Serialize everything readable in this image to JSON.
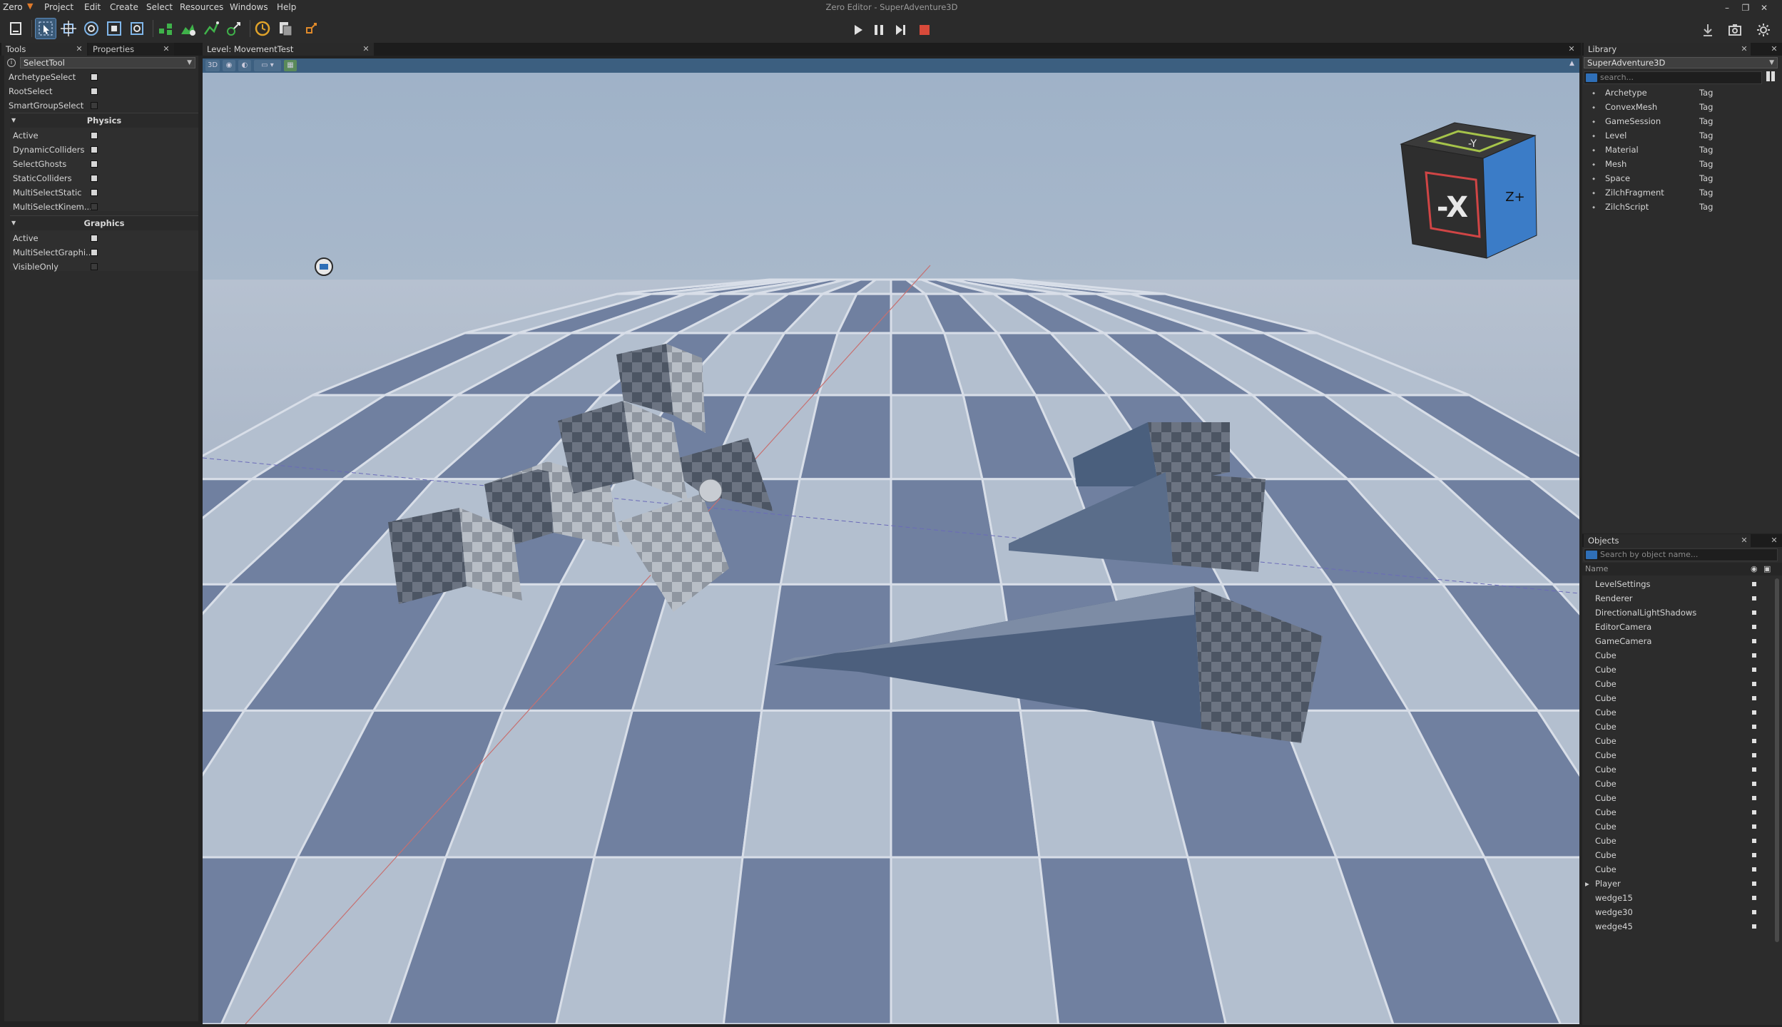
{
  "menu": {
    "logo": "Zero",
    "items": [
      "Project",
      "Edit",
      "Create",
      "Select",
      "Resources",
      "Windows",
      "Help"
    ],
    "title": "Zero Editor - SuperAdventure3D"
  },
  "colors": {
    "accent": "#3c5f80",
    "selection": "#2f6fb7",
    "stop": "#d84a3a",
    "tool_green": "#3fb24a",
    "tool_orange": "#e08a2a"
  },
  "tools_panel": {
    "tab_tools": "Tools",
    "tab_properties": "Properties",
    "selected_tool": "SelectTool",
    "top_props": [
      {
        "label": "ArchetypeSelect",
        "checked": true
      },
      {
        "label": "RootSelect",
        "checked": true
      },
      {
        "label": "SmartGroupSelect",
        "checked": false
      }
    ],
    "physics": {
      "title": "Physics",
      "props": [
        {
          "label": "Active",
          "checked": true
        },
        {
          "label": "DynamicColliders",
          "checked": true
        },
        {
          "label": "SelectGhosts",
          "checked": true
        },
        {
          "label": "StaticColliders",
          "checked": true
        },
        {
          "label": "MultiSelectStatic",
          "checked": true
        },
        {
          "label": "MultiSelectKinem...",
          "checked": false
        }
      ]
    },
    "graphics": {
      "title": "Graphics",
      "props": [
        {
          "label": "Active",
          "checked": true
        },
        {
          "label": "MultiSelectGraphi...",
          "checked": true
        },
        {
          "label": "VisibleOnly",
          "checked": false
        }
      ]
    }
  },
  "viewport": {
    "tab": "Level: MovementTest",
    "mode": "3D",
    "gizmo_label": "-X",
    "gizmo_top_label": "-Y",
    "gizmo_side_label": "Z+"
  },
  "library": {
    "tab": "Library",
    "project": "SuperAdventure3D",
    "search_placeholder": "search...",
    "items": [
      {
        "name": "Archetype",
        "tag": "Tag"
      },
      {
        "name": "ConvexMesh",
        "tag": "Tag"
      },
      {
        "name": "GameSession",
        "tag": "Tag"
      },
      {
        "name": "Level",
        "tag": "Tag"
      },
      {
        "name": "Material",
        "tag": "Tag"
      },
      {
        "name": "Mesh",
        "tag": "Tag"
      },
      {
        "name": "Space",
        "tag": "Tag"
      },
      {
        "name": "ZilchFragment",
        "tag": "Tag"
      },
      {
        "name": "ZilchScript",
        "tag": "Tag"
      }
    ]
  },
  "objects": {
    "tab": "Objects",
    "search_placeholder": "Search by object name...",
    "column_name": "Name",
    "items": [
      "LevelSettings",
      "Renderer",
      "DirectionalLightShadows",
      "EditorCamera",
      "GameCamera",
      "Cube",
      "Cube",
      "Cube",
      "Cube",
      "Cube",
      "Cube",
      "Cube",
      "Cube",
      "Cube",
      "Cube",
      "Cube",
      "Cube",
      "Cube",
      "Cube",
      "Cube",
      "Cube",
      "Player",
      "wedge15",
      "wedge30",
      "wedge45"
    ]
  }
}
